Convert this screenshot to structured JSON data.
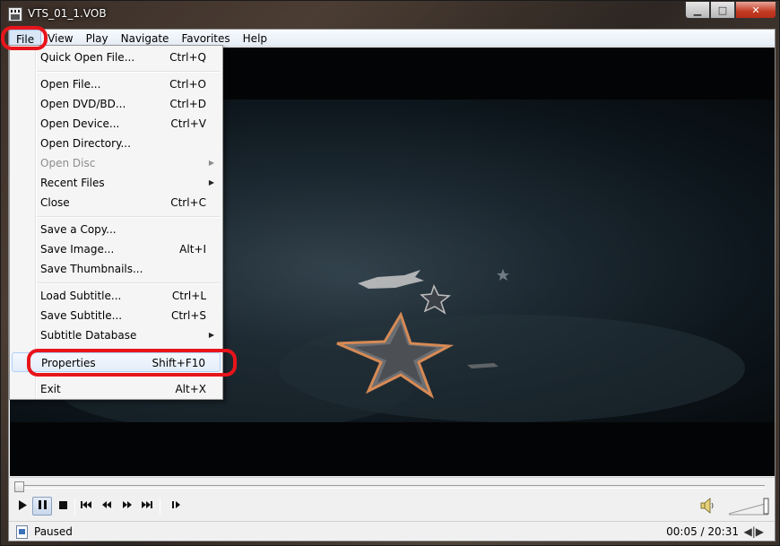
{
  "window": {
    "title": "VTS_01_1.VOB",
    "minimize_glyph": "▁",
    "maximize_glyph": "□",
    "close_glyph": "✕"
  },
  "menubar": {
    "items": [
      "File",
      "View",
      "Play",
      "Navigate",
      "Favorites",
      "Help"
    ]
  },
  "file_menu": {
    "items": [
      {
        "label": "Quick Open File...",
        "shortcut": "Ctrl+Q"
      },
      {
        "label": "Open File...",
        "shortcut": "Ctrl+O"
      },
      {
        "label": "Open DVD/BD...",
        "shortcut": "Ctrl+D"
      },
      {
        "label": "Open Device...",
        "shortcut": "Ctrl+V"
      },
      {
        "label": "Open Directory...",
        "shortcut": ""
      },
      {
        "label": "Open Disc",
        "shortcut": "",
        "submenu": true,
        "disabled": true
      },
      {
        "label": "Recent Files",
        "shortcut": "",
        "submenu": true
      },
      {
        "label": "Close",
        "shortcut": "Ctrl+C"
      },
      {
        "label": "Save a Copy...",
        "shortcut": ""
      },
      {
        "label": "Save Image...",
        "shortcut": "Alt+I"
      },
      {
        "label": "Save Thumbnails...",
        "shortcut": ""
      },
      {
        "label": "Load Subtitle...",
        "shortcut": "Ctrl+L"
      },
      {
        "label": "Save Subtitle...",
        "shortcut": "Ctrl+S"
      },
      {
        "label": "Subtitle Database",
        "shortcut": "",
        "submenu": true
      },
      {
        "label": "Properties",
        "shortcut": "Shift+F10"
      },
      {
        "label": "Exit",
        "shortcut": "Alt+X"
      }
    ]
  },
  "player": {
    "seek_position": 0.004,
    "volume_level": 1.0
  },
  "status": {
    "state": "Paused",
    "time": "00:05 / 20:31"
  },
  "icons": {
    "play": "play-icon",
    "pause": "pause-icon",
    "stop": "stop-icon",
    "prev": "skip-back-icon",
    "rewind": "rewind-icon",
    "forward": "fast-forward-icon",
    "next": "skip-forward-icon",
    "frame_step": "frame-step-icon",
    "volume": "speaker-icon"
  },
  "colors": {
    "annotation_red": "#e8141b"
  }
}
